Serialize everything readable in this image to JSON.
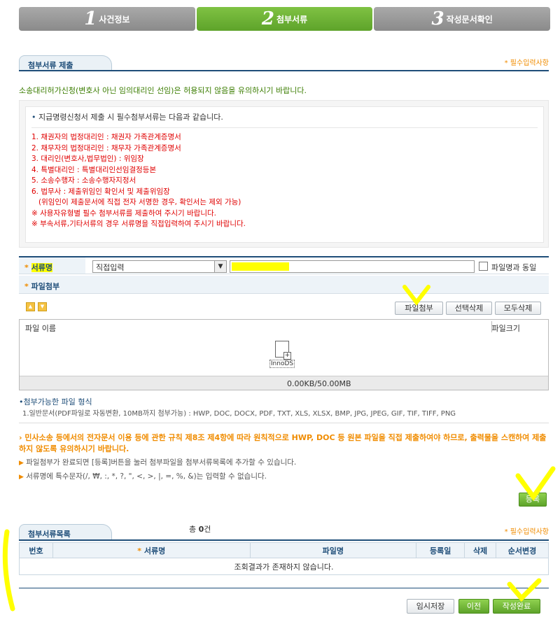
{
  "steps": [
    {
      "num": "1",
      "label": "사건정보",
      "active": false
    },
    {
      "num": "2",
      "label": "첨부서류",
      "active": true
    },
    {
      "num": "3",
      "label": "작성문서확인",
      "active": false
    }
  ],
  "submit_section": {
    "title": "첨부서류 제출",
    "required_note": "* 필수입력사항"
  },
  "notice": "소송대리허가신청(변호사 아닌 임의대리인 선임)은 허용되지 않음을 유의하시기 바랍니다.",
  "requirements": {
    "header": "지급명령신청서 제출 시 필수첨부서류는 다음과 같습니다.",
    "items": [
      "1. 채권자의 법정대리인 : 채권자 가족관계증명서",
      "2. 채무자의 법정대리인 : 채무자 가족관계증명서",
      "3. 대리인(변호사,법무법인) : 위임장",
      "4. 특별대리인 : 특별대리인선임결정등본",
      "5. 소송수행자 : 소송수행자지정서",
      "6. 법무사 : 제출위임인 확인서 및 제출위임장",
      "   (위임인이 제출문서에 직접 전자 서명한 경우, 확인서는 제외 가능)",
      "※ 사용자유형별 필수 첨부서류를 제출하여 주시기 바랍니다.",
      "※ 부속서류,기타서류의 경우 서류명을 직접입력하여 주시기 바랍니다."
    ]
  },
  "form": {
    "doc_name_label": "서류명",
    "doc_type_selected": "직접입력",
    "doc_name_value": "",
    "same_as_filename_label": "파일명과 동일",
    "file_attach_label": "파일첨부"
  },
  "uploader": {
    "buttons": {
      "attach": "파일첨부",
      "delete_selected": "선택삭제",
      "delete_all": "모두삭제"
    },
    "col_filename": "파일 이름",
    "col_filesize": "파일크기",
    "drop_icon_label": "InnoDS",
    "size_status": "0.00KB/50.00MB"
  },
  "allowed_types": {
    "heading": "첨부가능한 파일 형식",
    "text": "1.일반문서(PDF파일로 자동변환, 10MB까지 첨부가능) : HWP, DOC, DOCX, PDF, TXT, XLS, XLSX, BMP, JPG, JPEG, GIF, TIF, TIFF, PNG"
  },
  "warnings": {
    "bold": "민사소송 등에서의 전자문서 이용 등에 관한 규칙 제8조 제4항에 따라 원칙적으로 HWP, DOC 등 원본 파일을 직접 제출하여야 하므로, 출력물을 스캔하여 제출하지 않도록 유의하시기 바랍니다.",
    "line1": "파일첨부가 완료되면 [등록]버튼을 눌러 첨부파일을 첨부서류목록에 추가할 수 있습니다.",
    "line2": "서류명에 특수문자(/, ₩, :, *, ?, \", <, >, |, =, %, &)는 입력할 수 없습니다."
  },
  "register_button": "등록",
  "list_section": {
    "title": "첨부서류목록",
    "count_prefix": "총 ",
    "count": "0",
    "count_suffix": "건",
    "required_note": "* 필수입력사항",
    "columns": [
      "번호",
      "서류명",
      "파일명",
      "등록일",
      "삭제",
      "순서변경"
    ],
    "empty_message": "조회결과가 존재하지 않습니다."
  },
  "footer_buttons": {
    "temp_save": "임시저장",
    "prev": "이전",
    "complete": "작성완료"
  },
  "colors": {
    "accent_green": "#5ea32a",
    "brand_blue": "#1f4e79",
    "required_orange": "#f08c00",
    "warning_red": "#e00000",
    "highlight": "#ffff00"
  }
}
